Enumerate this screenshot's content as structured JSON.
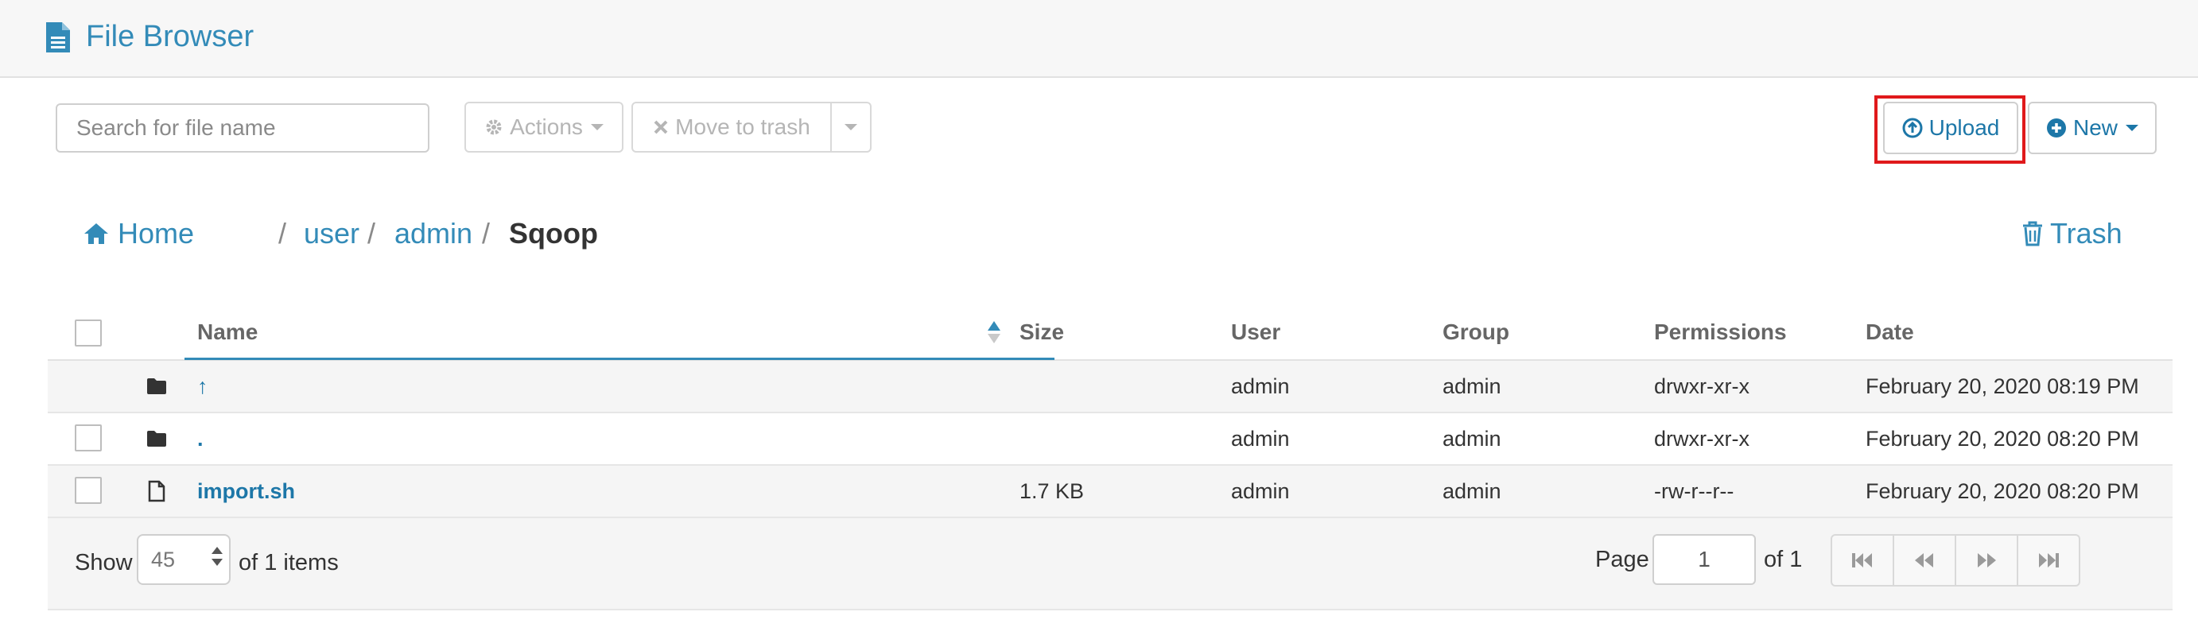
{
  "header": {
    "title": "File Browser",
    "icon": "file-text-icon"
  },
  "toolbar": {
    "search_placeholder": "Search for file name",
    "actions_label": "Actions",
    "move_to_trash_label": "Move to trash",
    "upload_label": "Upload",
    "new_label": "New"
  },
  "breadcrumb": {
    "home": "Home",
    "items": [
      "user",
      "admin"
    ],
    "separator": "/",
    "current": "Sqoop"
  },
  "trash_label": "Trash",
  "table": {
    "columns": [
      "Name",
      "Size",
      "User",
      "Group",
      "Permissions",
      "Date"
    ],
    "rows": [
      {
        "type": "folder",
        "name": "↑",
        "size": "",
        "user": "admin",
        "group": "admin",
        "permissions": "drwxr-xr-x",
        "date": "February 20, 2020 08:19 PM"
      },
      {
        "type": "folder",
        "name": ".",
        "size": "",
        "user": "admin",
        "group": "admin",
        "permissions": "drwxr-xr-x",
        "date": "February 20, 2020 08:20 PM"
      },
      {
        "type": "file",
        "name": "import.sh",
        "size": "1.7 KB",
        "user": "admin",
        "group": "admin",
        "permissions": "-rw-r--r--",
        "date": "February 20, 2020 08:20 PM"
      }
    ]
  },
  "footer": {
    "show_label": "Show",
    "page_size": "45",
    "of_items": "of 1 items",
    "page_label": "Page",
    "page_value": "1",
    "page_of": "of 1"
  },
  "colors": {
    "accent": "#338bb8",
    "link": "#1d77a8",
    "highlight": "#e0191b"
  }
}
